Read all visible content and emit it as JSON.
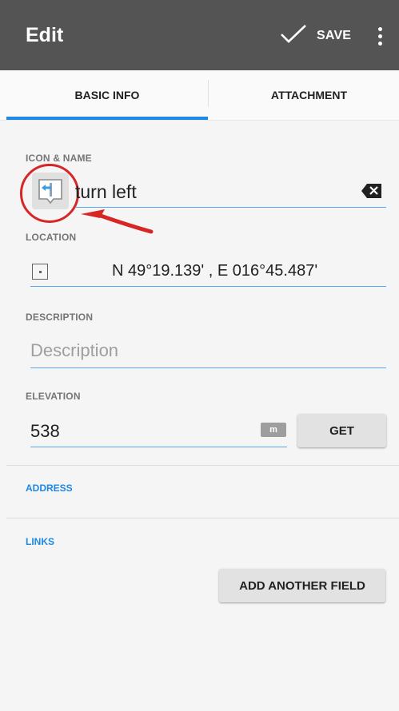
{
  "appbar": {
    "title": "Edit",
    "save_label": "SAVE",
    "check_icon": "check-icon",
    "menu_icon": "more-vert-icon"
  },
  "tabs": [
    {
      "label": "BASIC INFO",
      "active": true
    },
    {
      "label": "ATTACHMENT",
      "active": false
    }
  ],
  "icon_name": {
    "label": "ICON & NAME",
    "name_value": "turn left",
    "icon": "turn-left-sign-icon",
    "clear_icon": "backspace-icon"
  },
  "location": {
    "label": "LOCATION",
    "value": "N 49°19.139' , E 016°45.487'",
    "icon": "crosshair-square-icon"
  },
  "description": {
    "label": "DESCRIPTION",
    "placeholder": "Description"
  },
  "elevation": {
    "label": "ELEVATION",
    "value": "538",
    "unit": "m",
    "get_label": "GET"
  },
  "address": {
    "label": "ADDRESS"
  },
  "links": {
    "label": "LINKS",
    "add_field_label": "ADD ANOTHER FIELD"
  },
  "colors": {
    "appbar": "#545454",
    "accent": "#1e88e5",
    "annotation": "#d62626",
    "background": "#f5f5f5"
  }
}
